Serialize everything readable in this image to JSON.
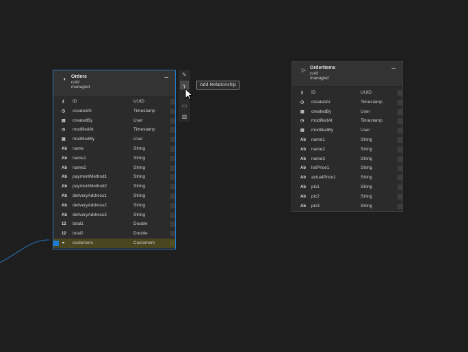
{
  "orders": {
    "title": "Orders",
    "sub1": "cuid",
    "sub2": "managed",
    "rows": [
      {
        "icon": "key-icon",
        "glyph": "⚷",
        "name": "ID",
        "type": "UUID"
      },
      {
        "icon": "timestamp-icon",
        "glyph": "◷",
        "name": "createdAt",
        "type": "Timestamp"
      },
      {
        "icon": "user-icon",
        "glyph": "▤",
        "name": "createdBy",
        "type": "User"
      },
      {
        "icon": "timestamp-icon",
        "glyph": "◷",
        "name": "modifiedAt",
        "type": "Timestamp"
      },
      {
        "icon": "user-icon",
        "glyph": "▤",
        "name": "modifiedBy",
        "type": "User"
      },
      {
        "icon": "string-icon",
        "glyph": "Ab",
        "name": "name",
        "type": "String"
      },
      {
        "icon": "string-icon",
        "glyph": "Ab",
        "name": "name1",
        "type": "String"
      },
      {
        "icon": "string-icon",
        "glyph": "Ab",
        "name": "name2",
        "type": "String"
      },
      {
        "icon": "string-icon",
        "glyph": "Ab",
        "name": "paymentMethod1",
        "type": "String"
      },
      {
        "icon": "string-icon",
        "glyph": "Ab",
        "name": "paymentMethod2",
        "type": "String"
      },
      {
        "icon": "string-icon",
        "glyph": "Ab",
        "name": "deliveryAddress1",
        "type": "String"
      },
      {
        "icon": "string-icon",
        "glyph": "Ab",
        "name": "deliveryAddress2",
        "type": "String"
      },
      {
        "icon": "string-icon",
        "glyph": "Ab",
        "name": "deliveryAddress3",
        "type": "String"
      },
      {
        "icon": "number-icon",
        "glyph": "12",
        "name": "total1",
        "type": "Double"
      },
      {
        "icon": "number-icon",
        "glyph": "12",
        "name": "total2",
        "type": "Double"
      },
      {
        "icon": "link-icon",
        "glyph": "⚭",
        "name": "customers",
        "type": "Customers",
        "highlight": true
      }
    ]
  },
  "orderitems": {
    "title": "OrderItems",
    "sub1": "cuid",
    "sub2": "managed",
    "rows": [
      {
        "icon": "key-icon",
        "glyph": "⚷",
        "name": "ID",
        "type": "UUID"
      },
      {
        "icon": "timestamp-icon",
        "glyph": "◷",
        "name": "createdAt",
        "type": "Timestamp"
      },
      {
        "icon": "user-icon",
        "glyph": "▤",
        "name": "createdBy",
        "type": "User"
      },
      {
        "icon": "timestamp-icon",
        "glyph": "◷",
        "name": "modifiedAt",
        "type": "Timestamp"
      },
      {
        "icon": "user-icon",
        "glyph": "▤",
        "name": "modifiedBy",
        "type": "User"
      },
      {
        "icon": "string-icon",
        "glyph": "Ab",
        "name": "name1",
        "type": "String"
      },
      {
        "icon": "string-icon",
        "glyph": "Ab",
        "name": "name2",
        "type": "String"
      },
      {
        "icon": "string-icon",
        "glyph": "Ab",
        "name": "name3",
        "type": "String"
      },
      {
        "icon": "string-icon",
        "glyph": "Ab",
        "name": "listPrice1",
        "type": "String"
      },
      {
        "icon": "string-icon",
        "glyph": "Ab",
        "name": "actualPrice1",
        "type": "String"
      },
      {
        "icon": "string-icon",
        "glyph": "Ab",
        "name": "pic1",
        "type": "String"
      },
      {
        "icon": "string-icon",
        "glyph": "Ab",
        "name": "pic2",
        "type": "String"
      },
      {
        "icon": "string-icon",
        "glyph": "Ab",
        "name": "pic3",
        "type": "String"
      }
    ]
  },
  "toolbar": {
    "buttons": [
      {
        "name": "edit-icon",
        "glyph": "✎"
      },
      {
        "name": "add-relationship-icon",
        "glyph": "┐"
      },
      {
        "name": "camera-icon",
        "glyph": "▭"
      },
      {
        "name": "delete-icon",
        "glyph": "🗑"
      }
    ],
    "tooltip": "Add Relationship"
  },
  "colors": {
    "canvas": "#1e1e1e",
    "selection": "#2a78c8",
    "highlight_row": "#4a4720"
  }
}
